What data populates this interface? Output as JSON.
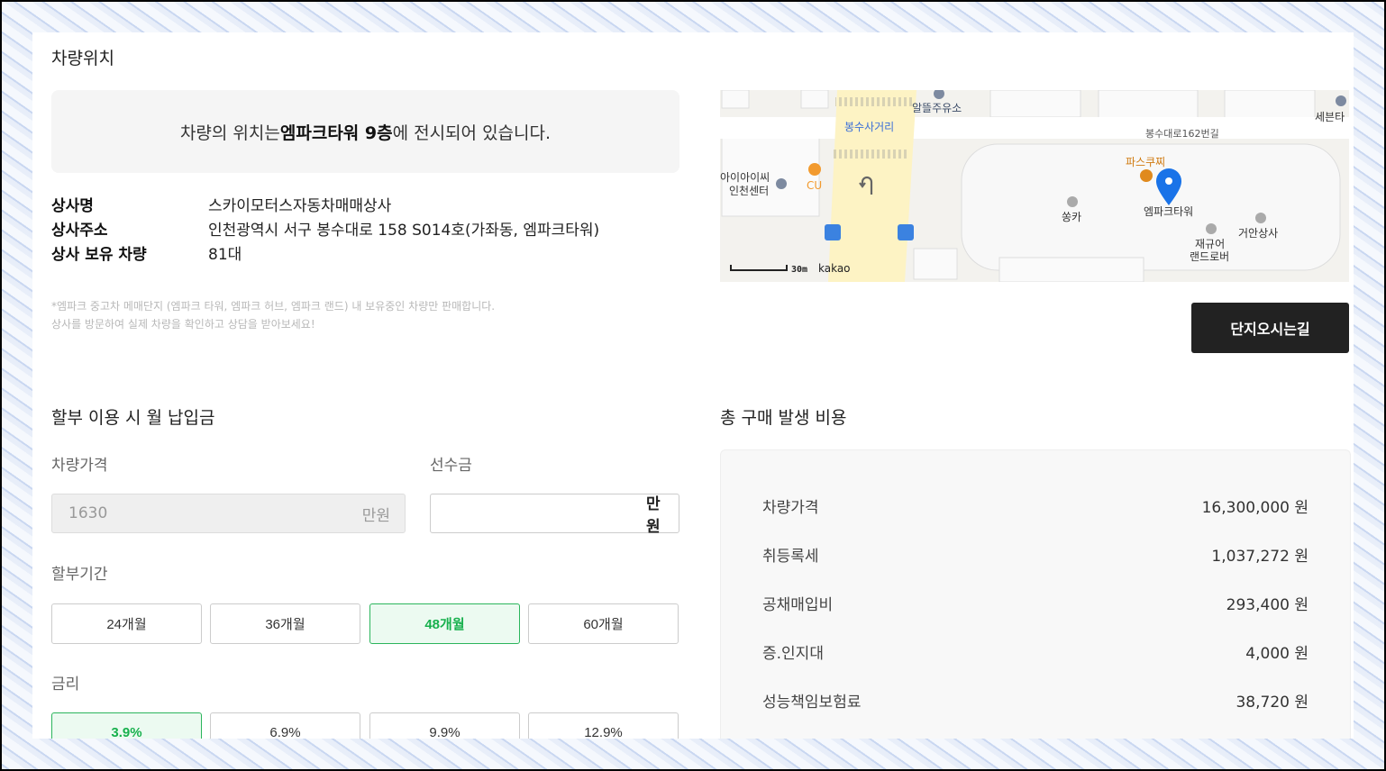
{
  "location": {
    "title": "차량위치",
    "notice_prefix": "차량의 위치는 ",
    "notice_bold": "엠파크타워 9층",
    "notice_suffix": "에 전시되어 있습니다.",
    "info": [
      {
        "key": "상사명",
        "value": "스카이모터스자동차매매상사"
      },
      {
        "key": "상사주소",
        "value": "인천광역시 서구 봉수대로 158 S014호(가좌동, 엠파크타워)"
      },
      {
        "key": "상사 보유 차량",
        "value": "81대"
      }
    ],
    "fine_print": [
      "*엠파크 중고차 메매단지 (엠파크 타워, 엠파크 허브, 엠파크 랜드) 내 보유중인 차량만 판매합니다.",
      "상사를 방문하여 실제 차량을 확인하고 상담을 받아보세요!"
    ],
    "directions_button": "단지오시는길"
  },
  "map": {
    "labels": {
      "gas": "알뜰주유소",
      "crossroad": "봉수사거리",
      "road": "봉수대로162번길",
      "sebenta": "세븐타",
      "iisi": "아이아이씨",
      "center": "인천센터",
      "cu": "CU",
      "paskucci": "파스쿠찌",
      "ssongka": "쏭카",
      "empark": "엠파크타워",
      "geoan": "거안상사",
      "jaeguar1": "재규어",
      "jaeguar2": "랜드로버",
      "scale": "30m",
      "brand": "kakao"
    }
  },
  "installment": {
    "title": "할부 이용 시 월 납입금",
    "price_label": "차량가격",
    "price_value": "1630",
    "price_unit": "만원",
    "down_label": "선수금",
    "down_value": "",
    "down_unit": "만원",
    "period_label": "할부기간",
    "periods": [
      "24개월",
      "36개월",
      "48개월",
      "60개월"
    ],
    "period_selected": 2,
    "rate_label": "금리",
    "rates": [
      "3.9%",
      "6.9%",
      "9.9%",
      "12.9%"
    ],
    "rate_selected": 0
  },
  "costs": {
    "title": "총 구매 발생 비용",
    "rows": [
      {
        "label": "차량가격",
        "value": "16,300,000 원"
      },
      {
        "label": "취등록세",
        "value": "1,037,272 원"
      },
      {
        "label": "공채매입비",
        "value": "293,400 원"
      },
      {
        "label": "증.인지대",
        "value": "4,000 원"
      },
      {
        "label": "성능책임보험료",
        "value": "38,720 원"
      }
    ]
  },
  "colors": {
    "accent": "#17b04d",
    "pin": "#1a73e8",
    "dark_button": "#222222"
  }
}
